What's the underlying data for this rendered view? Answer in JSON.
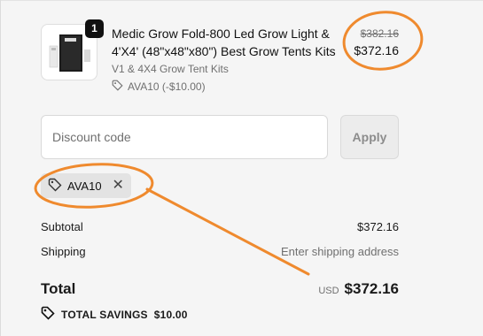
{
  "line_item": {
    "quantity": "1",
    "title": "Medic Grow Fold-800 Led Grow Light & 4'X4' (48\"x48\"x80\") Best Grow Tents Kits",
    "variant": "V1 & 4X4 Grow Tent Kits",
    "applied_discount": "AVA10 (-$10.00)",
    "compare_at_price": "$382.16",
    "price": "$372.16"
  },
  "discount_form": {
    "placeholder": "Discount code",
    "value": "",
    "apply_label": "Apply"
  },
  "applied_code": {
    "code": "AVA10",
    "remove_glyph": "✕"
  },
  "summary": {
    "subtotal_label": "Subtotal",
    "subtotal_value": "$372.16",
    "shipping_label": "Shipping",
    "shipping_value": "Enter shipping address",
    "total_label": "Total",
    "currency": "USD",
    "total_value": "$372.16",
    "savings_label": "TOTAL SAVINGS",
    "savings_value": "$10.00"
  },
  "colors": {
    "annotation": "#ef8a2e",
    "background": "#f5f5f5"
  },
  "icons": [
    "tag-icon",
    "close-icon",
    "product-thumbnail"
  ]
}
